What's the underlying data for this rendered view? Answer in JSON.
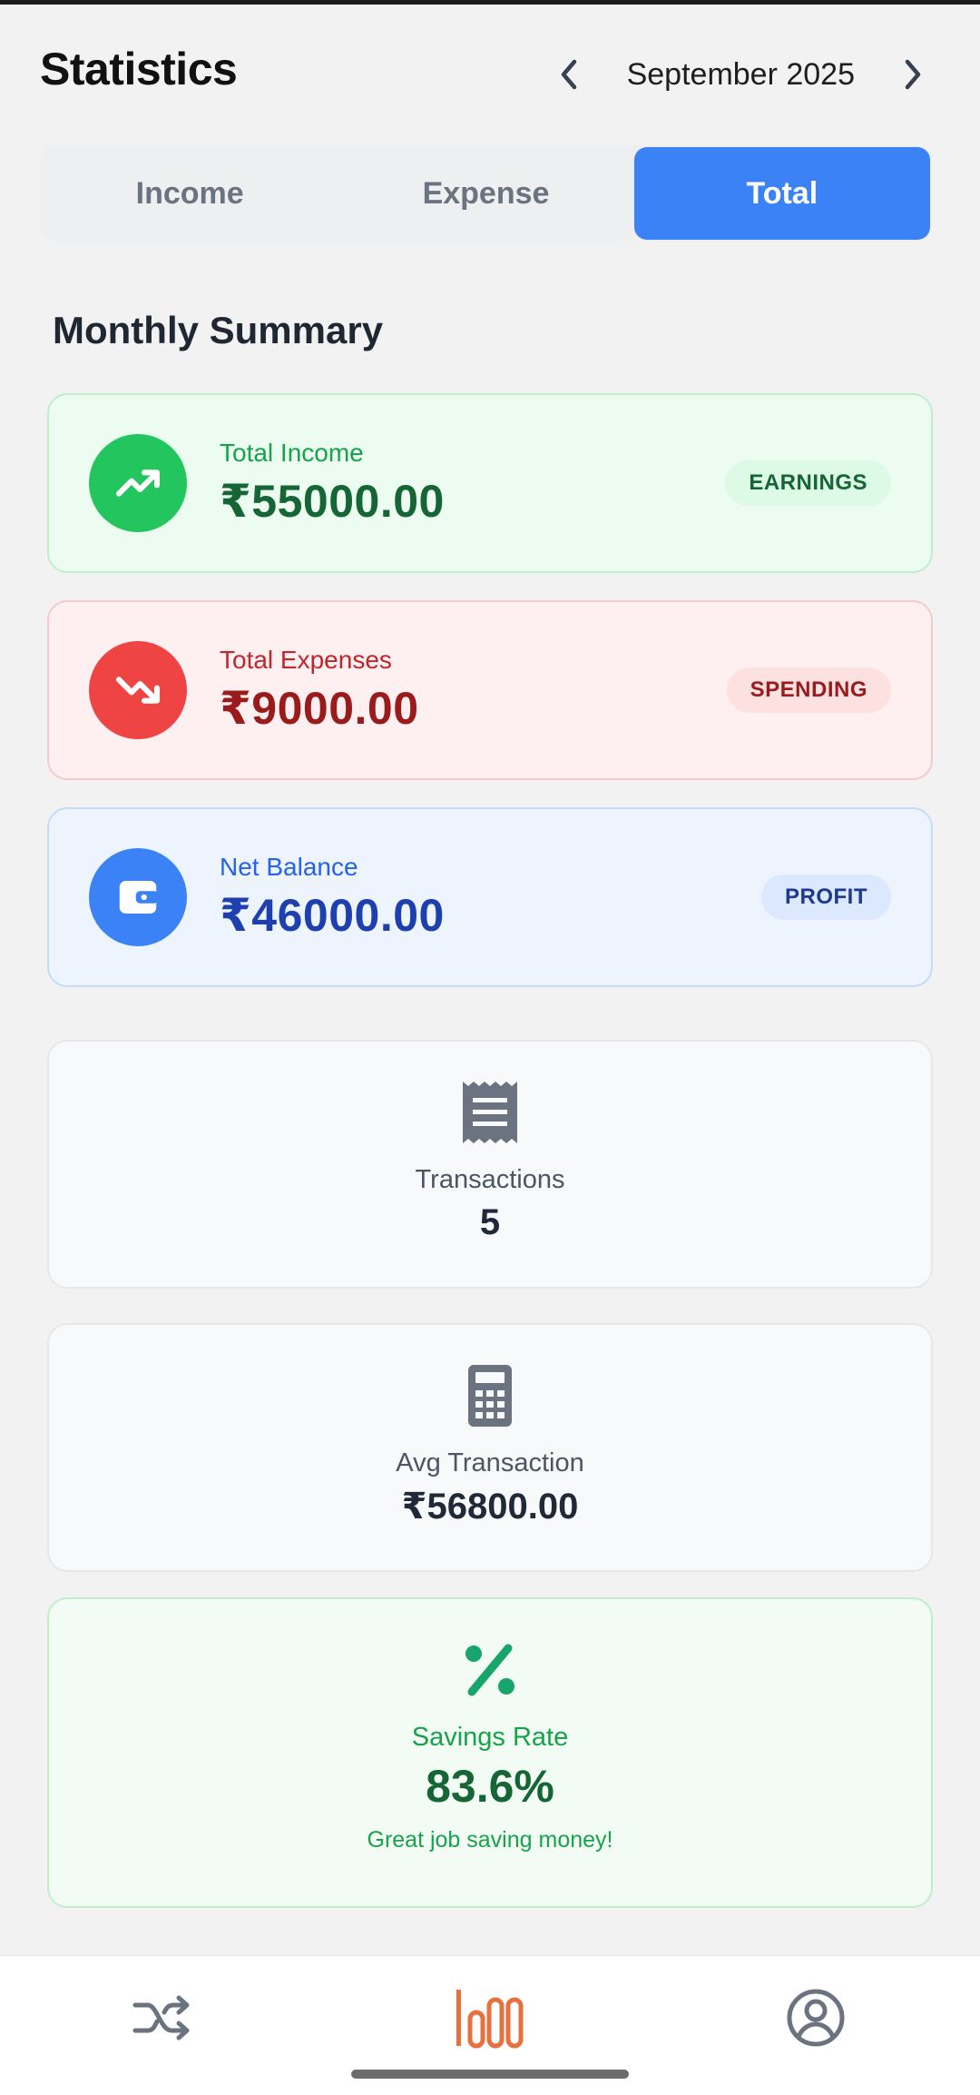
{
  "header": {
    "title": "Statistics",
    "month": "September 2025"
  },
  "tabs": [
    {
      "label": "Income",
      "active": false
    },
    {
      "label": "Expense",
      "active": false
    },
    {
      "label": "Total",
      "active": true
    }
  ],
  "section_title": "Monthly Summary",
  "summary": {
    "income": {
      "label": "Total Income",
      "amount": "₹55000.00",
      "badge": "EARNINGS",
      "icon": "trending-up-icon"
    },
    "expenses": {
      "label": "Total Expenses",
      "amount": "₹9000.00",
      "badge": "SPENDING",
      "icon": "trending-down-icon"
    },
    "balance": {
      "label": "Net Balance",
      "amount": "₹46000.00",
      "badge": "PROFIT",
      "icon": "wallet-icon"
    }
  },
  "stats": {
    "transactions": {
      "label": "Transactions",
      "value": "5",
      "icon": "receipt-icon"
    },
    "avg": {
      "label": "Avg Transaction",
      "value": "₹56800.00",
      "icon": "calculator-icon"
    },
    "savings": {
      "label": "Savings Rate",
      "value": "83.6%",
      "note": "Great job saving money!",
      "icon": "percent-icon"
    }
  },
  "bottom_nav": [
    {
      "name": "transactions",
      "icon": "shuffle-icon",
      "active": false
    },
    {
      "name": "statistics",
      "icon": "bar-chart-icon",
      "active": true
    },
    {
      "name": "profile",
      "icon": "account-circle-icon",
      "active": false
    }
  ],
  "colors": {
    "accent": "#3b82f6",
    "income": "#23c55e",
    "expense": "#ef4444",
    "nav_active": "#e8703f"
  }
}
